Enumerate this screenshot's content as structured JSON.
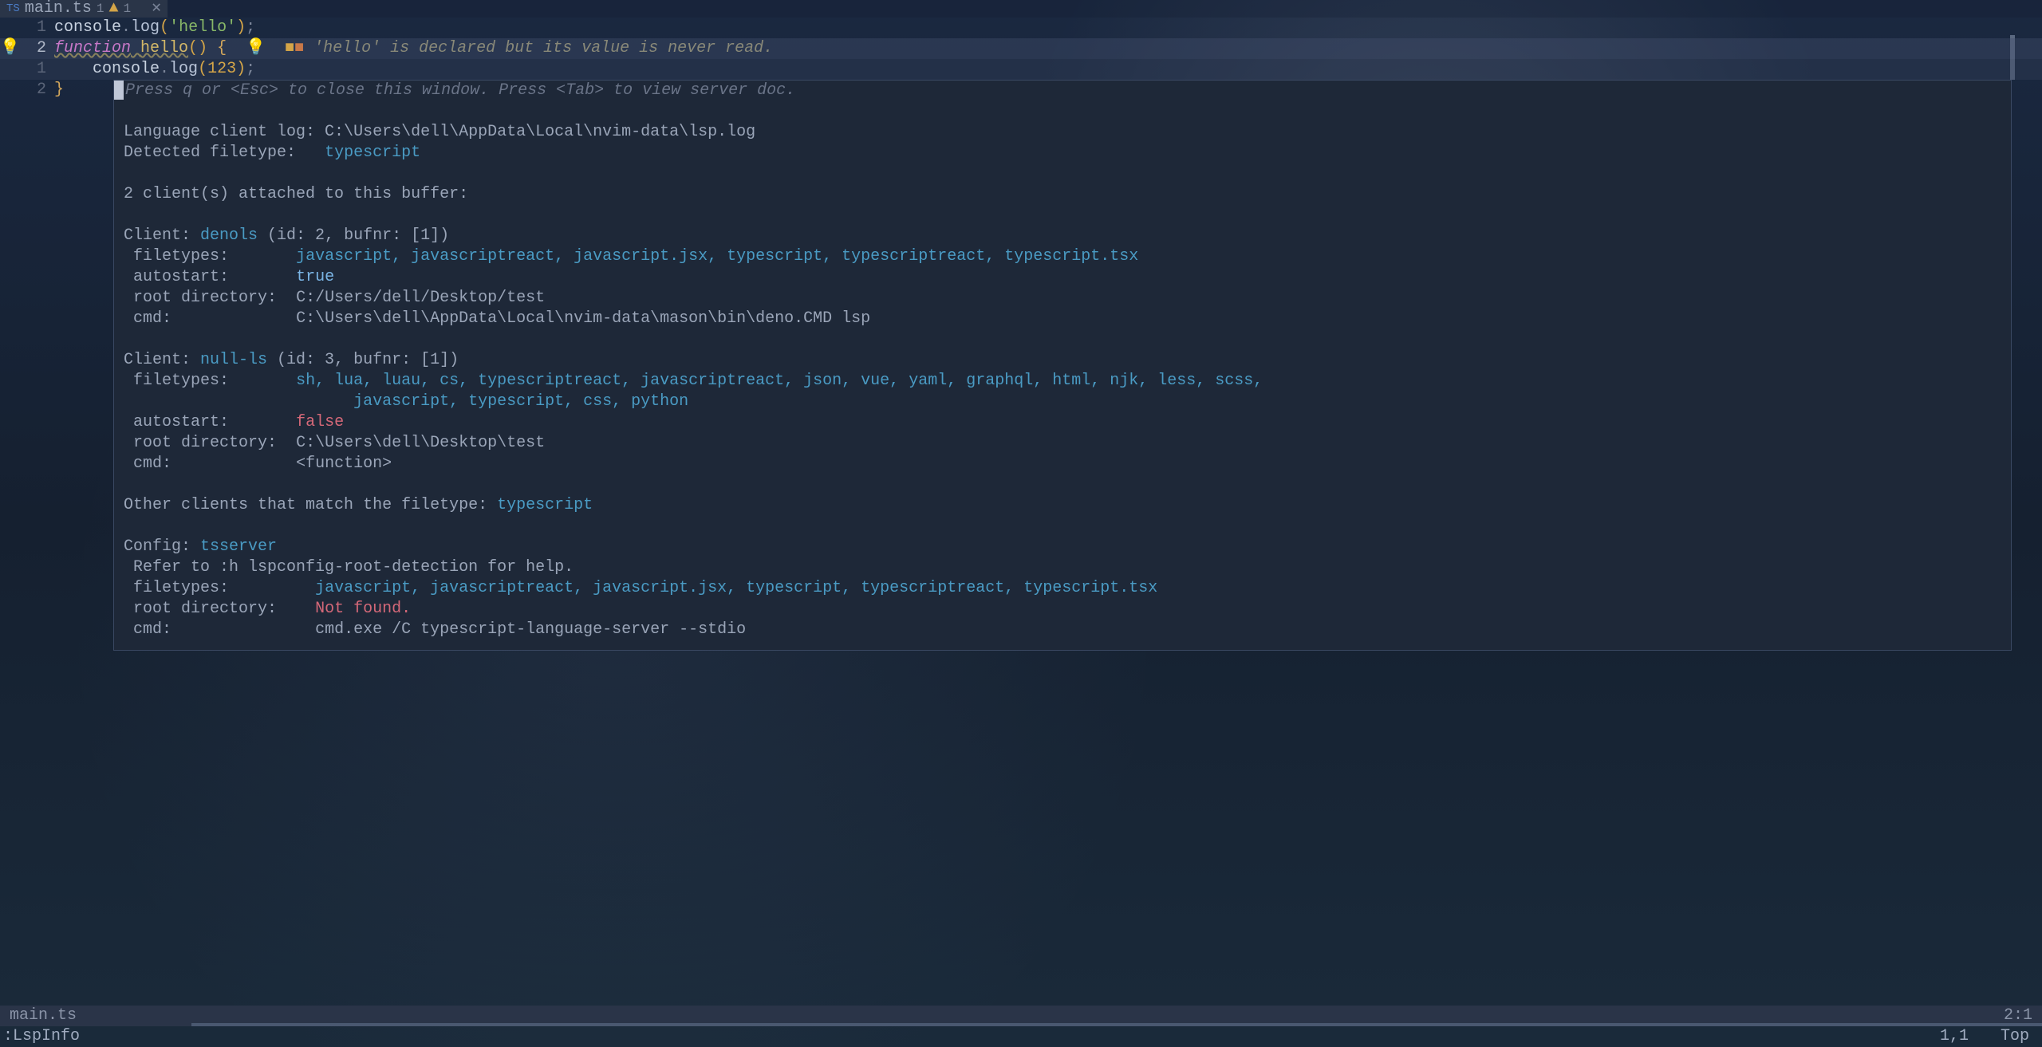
{
  "tab": {
    "icon_label": "TS",
    "filename": "main.ts",
    "indicator_count": "1",
    "warn_count": "1",
    "close": "✕"
  },
  "code": {
    "l1": {
      "num": "1",
      "console": "console",
      "dot": ".",
      "log": "log",
      "po": "(",
      "str": "'hello'",
      "pc": ")",
      "semi": ";"
    },
    "l2": {
      "sign": "💡",
      "num": "2",
      "kw": "function",
      "name": "hello",
      "po": "(",
      "pc": ")",
      "brace": " {",
      "bulb": "💡",
      "marks": "■■",
      "diag": "'hello' is declared but its value is never read."
    },
    "l3": {
      "num": "1",
      "indent": "    ",
      "console": "console",
      "dot": ".",
      "log": "log",
      "po": "(",
      "num_val": "123",
      "pc": ")",
      "semi": ";"
    },
    "l4": {
      "num": "2",
      "brace": "}"
    }
  },
  "lspinfo": {
    "hint": "Press q or <Esc> to close this window. Press <Tab> to view server doc.",
    "log_line": "Language client log: C:\\Users\\dell\\AppData\\Local\\nvim-data\\lsp.log",
    "detected_label": "Detected filetype:   ",
    "detected_type": "typescript",
    "clients_attached": "2 client(s) attached to this buffer:",
    "client1": {
      "prefix": "Client: ",
      "name": "denols",
      "suffix": " (id: 2, bufnr: [1])",
      "filetypes_label": " filetypes:       ",
      "filetypes": "javascript, javascriptreact, javascript.jsx, typescript, typescriptreact, typescript.tsx",
      "autostart_label": " autostart:       ",
      "autostart": "true",
      "rootdir_label": " root directory:  ",
      "rootdir": "C:/Users/dell/Desktop/test",
      "cmd_label": " cmd:             ",
      "cmd": "C:\\Users\\dell\\AppData\\Local\\nvim-data\\mason\\bin\\deno.CMD lsp"
    },
    "client2": {
      "prefix": "Client: ",
      "name": "null-ls",
      "suffix": " (id: 3, bufnr: [1])",
      "filetypes_label": " filetypes:       ",
      "filetypes_line1": "sh, lua, luau, cs, typescriptreact, javascriptreact, json, vue, yaml, graphql, html, njk, less, scss,",
      "filetypes_line2_indent": "                        ",
      "filetypes_line2": "javascript, typescript, css, python",
      "autostart_label": " autostart:       ",
      "autostart": "false",
      "rootdir_label": " root directory:  ",
      "rootdir": "C:\\Users\\dell\\Desktop\\test",
      "cmd_label": " cmd:             ",
      "cmd": "<function>"
    },
    "other_label": "Other clients that match the filetype: ",
    "other_type": "typescript",
    "config": {
      "prefix": "Config: ",
      "name": "tsserver",
      "refer": " Refer to :h lspconfig-root-detection for help.",
      "filetypes_label": " filetypes:         ",
      "filetypes": "javascript, javascriptreact, javascript.jsx, typescript, typescriptreact, typescript.tsx",
      "rootdir_label": " root directory:    ",
      "rootdir": "Not found.",
      "cmd_label": " cmd:               ",
      "cmd": "cmd.exe /C typescript-language-server --stdio"
    }
  },
  "statusline": {
    "filename": "main.ts",
    "position": "2:1"
  },
  "cmdline": {
    "cmd": ":LspInfo",
    "pos": "1,1",
    "scroll": "Top"
  }
}
